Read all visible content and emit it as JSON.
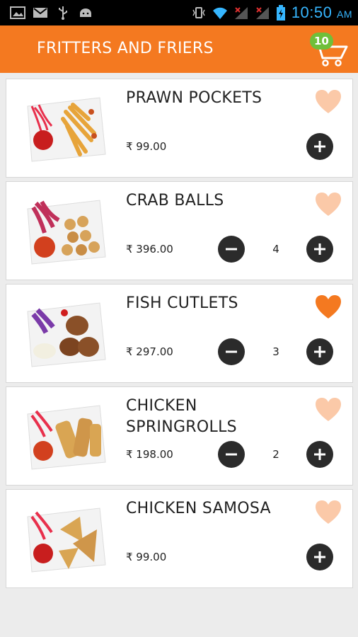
{
  "status_bar": {
    "time": "10:50",
    "ampm": "AM",
    "icons": [
      "gallery-icon",
      "gmail-icon",
      "usb-icon",
      "android-icon",
      "vibrate-icon",
      "wifi-icon",
      "signal-icon",
      "signal-icon",
      "battery-icon"
    ]
  },
  "header": {
    "title": "FRITTERS AND FRIERS",
    "cart_count": "10",
    "colors": {
      "bar": "#f47920",
      "badge": "#6fbf3a"
    }
  },
  "items": [
    {
      "name": "PRAWN POCKETS",
      "price": "₹ 99.00",
      "qty": "",
      "favorite": false
    },
    {
      "name": "CRAB BALLS",
      "price": "₹ 396.00",
      "qty": "4",
      "favorite": false
    },
    {
      "name": "FISH CUTLETS",
      "price": "₹ 297.00",
      "qty": "3",
      "favorite": true
    },
    {
      "name": "CHICKEN SPRINGROLLS",
      "price": "₹ 198.00",
      "qty": "2",
      "favorite": false
    },
    {
      "name": "CHICKEN SAMOSA",
      "price": "₹ 99.00",
      "qty": "",
      "favorite": false
    }
  ],
  "colors": {
    "heart_on": "#f47920",
    "heart_off": "#fbc9a8",
    "button": "#2b2b2b"
  }
}
